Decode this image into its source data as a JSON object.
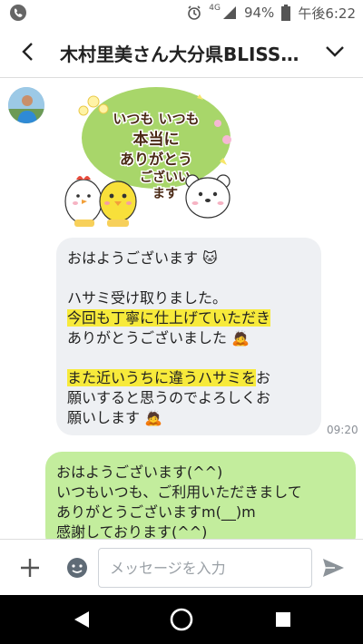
{
  "status_bar": {
    "network": "4G",
    "battery": "94%",
    "time": "午後6:22",
    "icons": [
      "phone-call-icon",
      "alarm-icon",
      "signal-icon",
      "battery-icon"
    ]
  },
  "header": {
    "title": "木村里美さん大分県BLISS…",
    "icons": [
      "back-chevron-icon",
      "chevron-down-icon"
    ]
  },
  "messages": {
    "sticker": {
      "lines": [
        "いつも いつも",
        "本当に",
        "ありがとう",
        "ございい",
        "ます"
      ]
    },
    "incoming": {
      "line1": "おはようございます",
      "line2": "ハサミ受け取りました。",
      "line3_hl": "今回も丁寧に仕上げていただき",
      "line4": "ありがとうございました",
      "line5_hl": "また近いうちに違うハサミを",
      "line5_rest": "お",
      "line6": "願いすると思うのでよろしくお",
      "line7": "願いします",
      "time": "09:20"
    },
    "outgoing": {
      "line1": "おはようございます(^^)",
      "line2": "いつもいつも、ご利用いただきまして",
      "line3": "ありがとうございますm(__)m",
      "line4": "感謝しております(^^)"
    }
  },
  "input_bar": {
    "placeholder": "メッセージを入力",
    "icons": [
      "plus-icon",
      "emoji-icon",
      "send-icon"
    ]
  },
  "colors": {
    "incoming_bubble": "#eef0f3",
    "outgoing_bubble": "#c3ed9d",
    "highlight": "#f7ea3b"
  }
}
